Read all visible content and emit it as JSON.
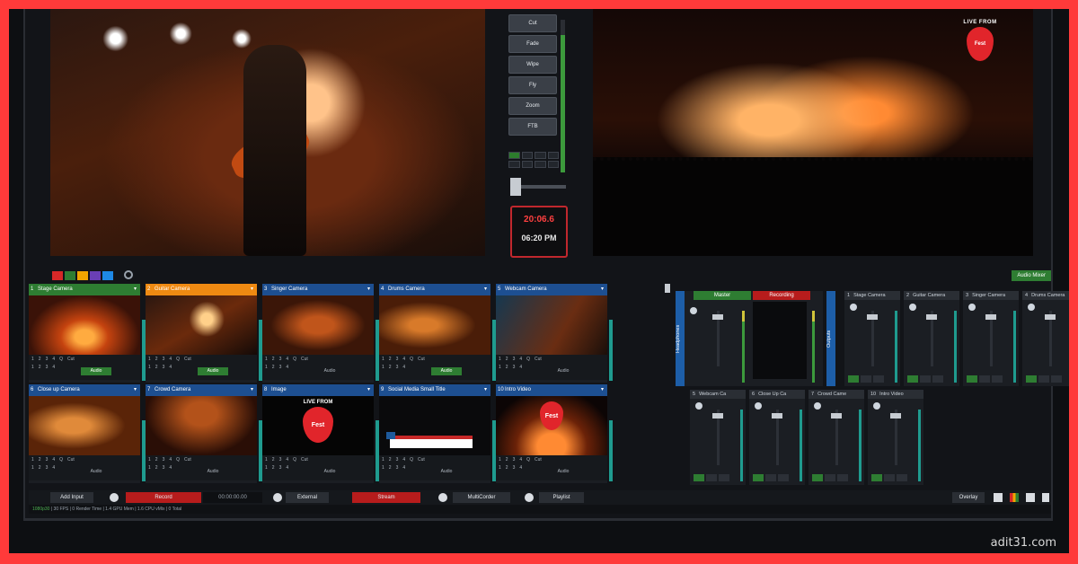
{
  "watermark": "adit31.com",
  "output_preview": {
    "badge_line1": "LIVE FROM",
    "badge_line2": "Fest"
  },
  "transitions": {
    "buttons": [
      "Cut",
      "Fade",
      "Wipe",
      "Fly",
      "Zoom",
      "FTB"
    ]
  },
  "clock": {
    "elapsed": "20:06.6",
    "time": "06:20 PM"
  },
  "toolbar": {
    "colors": [
      "#d62828",
      "#2e7d32",
      "#f0a500",
      "#6a3fb5",
      "#1e88e5"
    ],
    "audio_mixer_label": "Audio Mixer"
  },
  "inputs": [
    {
      "num": "1",
      "title": "Stage Camera",
      "header_color": "#2e7d32",
      "thumb": "t-fire",
      "audio_active": true,
      "logo": false,
      "lower_third": false
    },
    {
      "num": "2",
      "title": "Guitar Camera",
      "header_color": "#ef8a12",
      "thumb": "t-guitar",
      "audio_active": true,
      "logo": false,
      "lower_third": false
    },
    {
      "num": "3",
      "title": "Singer Camera",
      "header_color": "#1d4f91",
      "thumb": "t-band",
      "audio_active": false,
      "logo": false,
      "lower_third": false
    },
    {
      "num": "4",
      "title": "Drums Camera",
      "header_color": "#1d4f91",
      "thumb": "t-drum",
      "audio_active": true,
      "logo": false,
      "lower_third": false
    },
    {
      "num": "5",
      "title": "Webcam Camera",
      "header_color": "#1d4f91",
      "thumb": "t-stage",
      "audio_active": false,
      "logo": false,
      "lower_third": false
    },
    {
      "num": "6",
      "title": "Close up Camera",
      "header_color": "#1d4f91",
      "thumb": "t-close",
      "audio_active": false,
      "logo": false,
      "lower_third": false
    },
    {
      "num": "7",
      "title": "Crowd Camera",
      "header_color": "#1d4f91",
      "thumb": "t-crowd",
      "audio_active": false,
      "logo": false,
      "lower_third": false
    },
    {
      "num": "8",
      "title": "Image",
      "header_color": "#1d4f91",
      "thumb": "t-black",
      "audio_active": false,
      "logo": true,
      "lower_third": false
    },
    {
      "num": "9",
      "title": "Social Media Small Title",
      "header_color": "#1d4f91",
      "thumb": "t-dark",
      "audio_active": false,
      "logo": false,
      "lower_third": true
    },
    {
      "num": "10",
      "title": "Intro Video",
      "header_color": "#1d4f91",
      "thumb": "t-fest",
      "audio_active": false,
      "logo": true,
      "lower_third": false
    }
  ],
  "input_controls": {
    "row1": [
      "1",
      "2",
      "3",
      "4",
      "Q",
      "Cut"
    ],
    "row2": [
      "1",
      "2",
      "3",
      "4"
    ],
    "audio": "Audio",
    "logo_text": "LIVE FROM",
    "logo_pick": "Fest"
  },
  "mixer": {
    "master_label": "Master",
    "recording_label": "Recording",
    "side_a": "Headphones",
    "side_b": "Outputs",
    "row1": [
      {
        "num": "1",
        "label": "Stage Camera"
      },
      {
        "num": "2",
        "label": "Guitar Camera"
      },
      {
        "num": "3",
        "label": "Singer Camera"
      },
      {
        "num": "4",
        "label": "Drums Camera"
      }
    ],
    "row2": [
      {
        "num": "5",
        "label": "Webcam Ca"
      },
      {
        "num": "6",
        "label": "Close Up Ca"
      },
      {
        "num": "7",
        "label": "Crowd Came"
      },
      {
        "num": "10",
        "label": "Intro Video"
      }
    ]
  },
  "bottombar": {
    "add_input": "Add Input",
    "record": "Record",
    "record_time": "00:00:00.00",
    "external": "External",
    "stream": "Stream",
    "multicorder": "MultiCorder",
    "playlist": "Playlist",
    "overlay": "Overlay"
  },
  "statusbar": {
    "res": "1080p30",
    "text": "| 30  FPS  |  0  Render Time  |  1.4  GPU Mem  |  1.6  CPU vMix  |  0  Total"
  }
}
